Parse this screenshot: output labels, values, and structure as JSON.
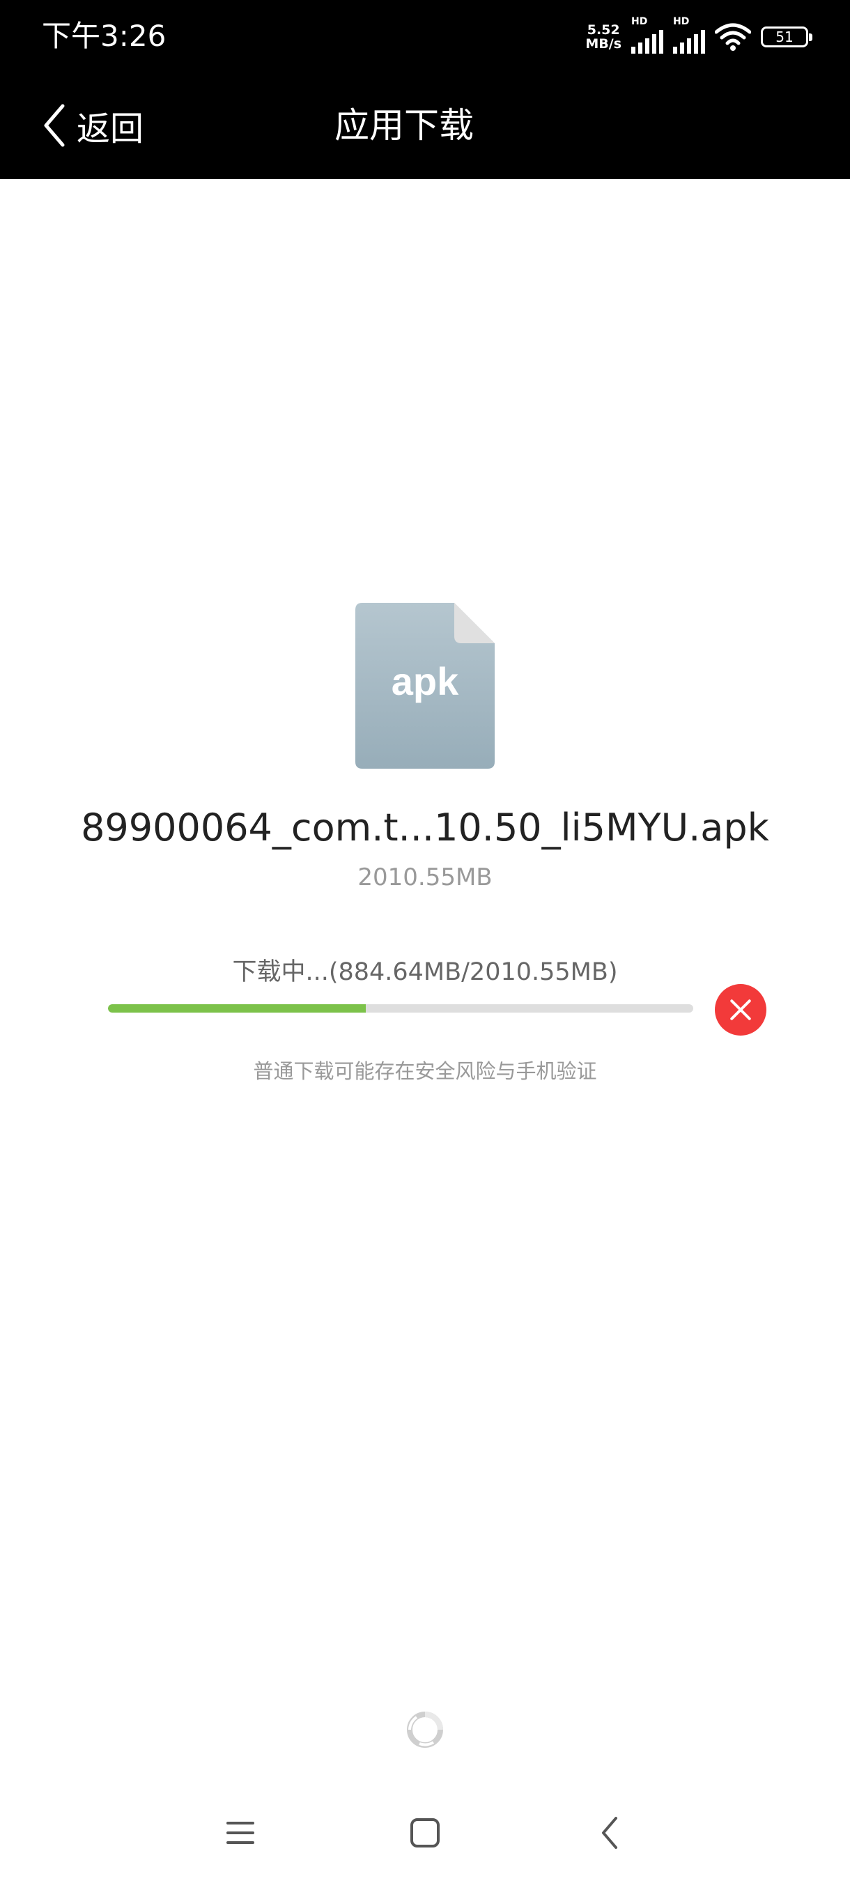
{
  "status_bar": {
    "time": "下午3:26",
    "net_speed_value": "5.52",
    "net_speed_unit": "MB/s",
    "signal_label": "HD",
    "battery": "51"
  },
  "header": {
    "back_label": "返回",
    "title": "应用下载"
  },
  "download": {
    "file_type_label": "apk",
    "file_name": "89900064_com.t...10.50_li5MYU.apk",
    "file_size": "2010.55MB",
    "progress_text": "下载中...(884.64MB/2010.55MB)",
    "progress_fraction": 0.44,
    "notice": "普通下载可能存在安全风险与手机验证"
  },
  "colors": {
    "progress": "#7cc24a",
    "cancel": "#f23a3a",
    "file_icon": "#a2b4bf"
  },
  "icons": {
    "back": "chevron-left-icon",
    "cancel": "close-icon",
    "file": "apk-file-icon",
    "loading": "loading-icon",
    "nav_menu": "menu-icon",
    "nav_home": "home-icon",
    "nav_back": "back-icon"
  }
}
